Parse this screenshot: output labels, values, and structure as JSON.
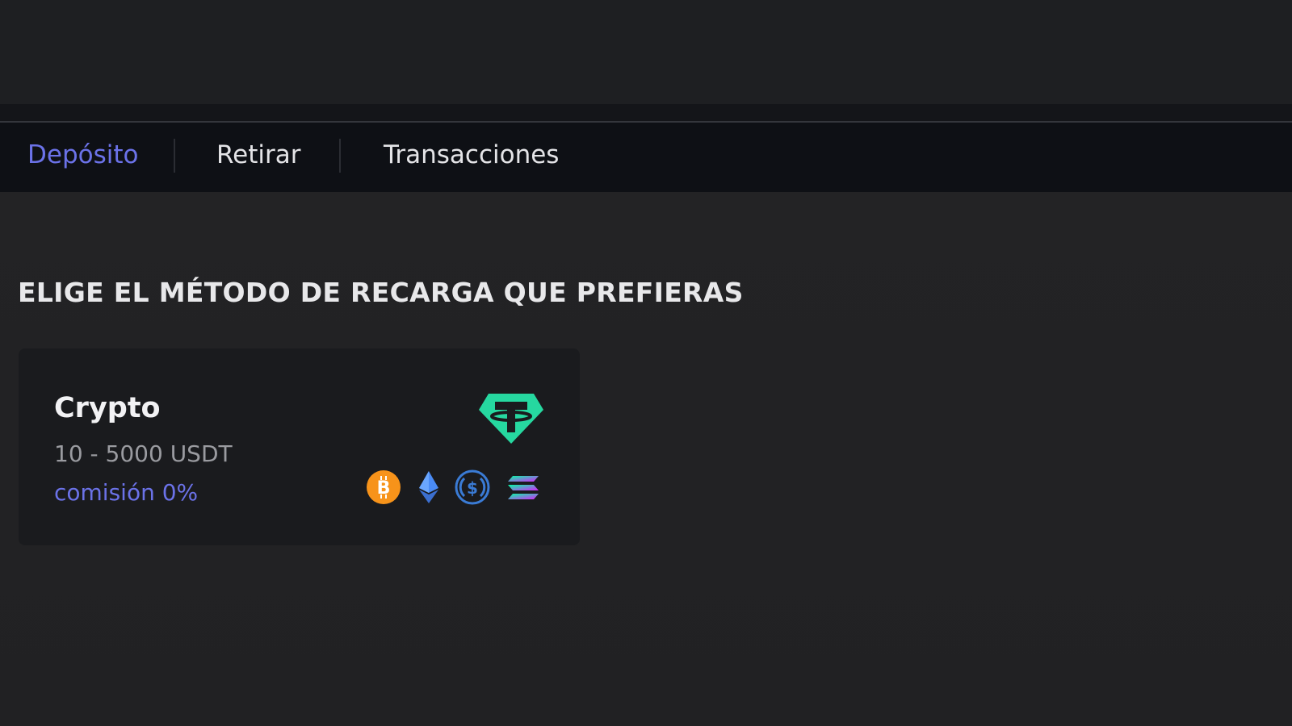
{
  "tabs": [
    {
      "label": "Depósito",
      "active": true
    },
    {
      "label": "Retirar",
      "active": false
    },
    {
      "label": "Transacciones",
      "active": false
    }
  ],
  "section": {
    "title": "ELIGE EL MÉTODO DE RECARGA QUE PREFIERAS"
  },
  "method_card": {
    "title": "Crypto",
    "range": "10 - 5000 USDT",
    "fee": "comisión 0%",
    "main_icon": "tether-icon",
    "coin_icons": [
      "bitcoin-icon",
      "ethereum-icon",
      "usdc-icon",
      "solana-icon"
    ]
  },
  "colors": {
    "accent": "#6b72e8",
    "tether_green": "#26d8a0",
    "bitcoin_orange": "#f7931a",
    "ethereum_blue": "#4a8bf5",
    "usdc_blue": "#3a7bd5"
  }
}
